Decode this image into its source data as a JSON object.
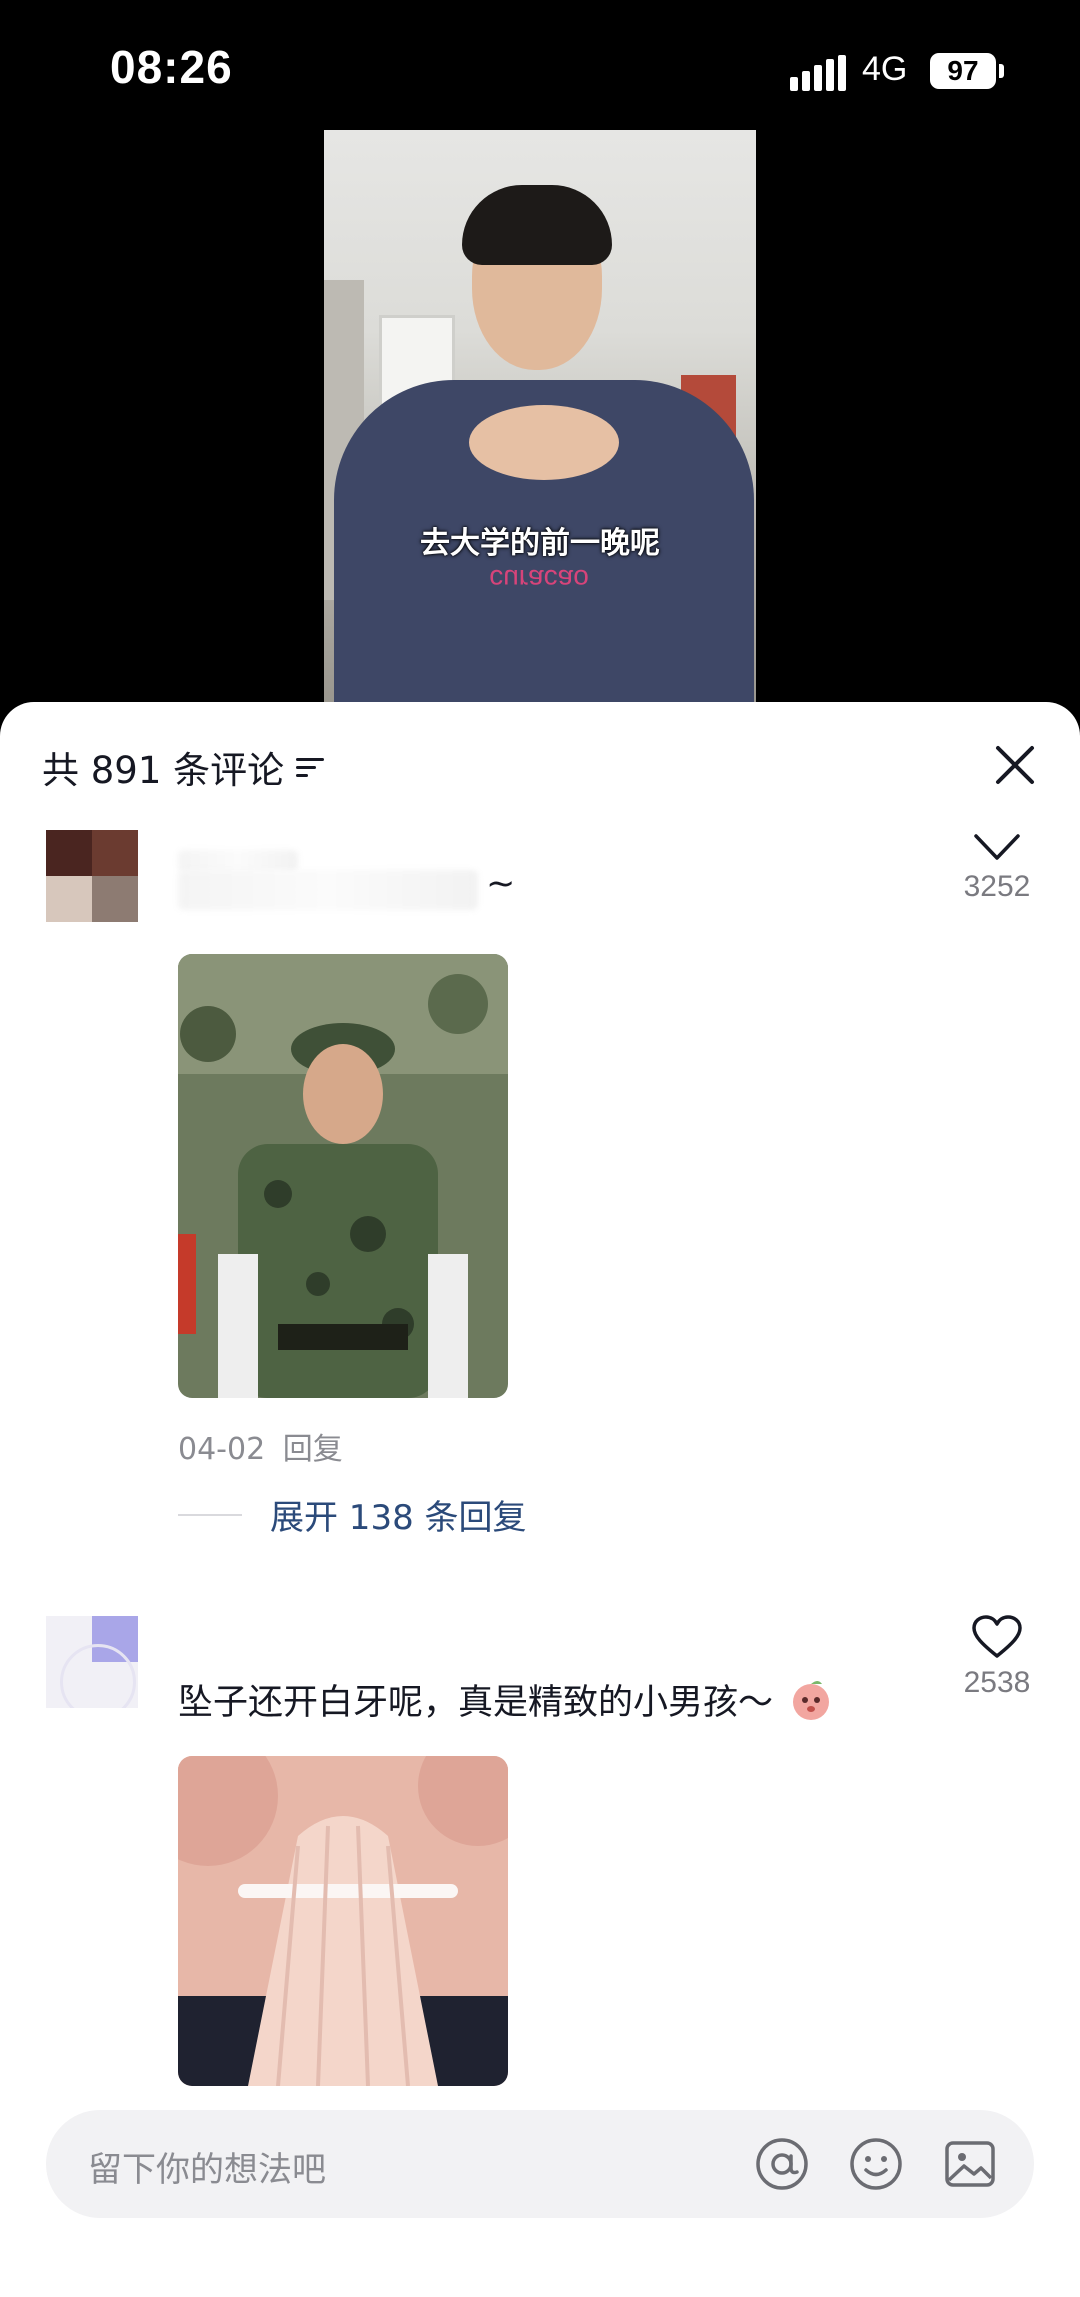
{
  "status_bar": {
    "time": "08:26",
    "network": "4G",
    "battery": "97"
  },
  "video": {
    "caption": "去大学的前一晚呢",
    "shirt_text": "curacao"
  },
  "comments_header": {
    "title": "共 891 条评论"
  },
  "comments": [
    {
      "text_suffix": "~",
      "likes": "3252",
      "date": "04-02",
      "reply_label": "回复",
      "expand_label": "展开 138 条回复"
    },
    {
      "text": "坠子还开白牙呢，真是精致的小男孩～",
      "likes": "2538"
    }
  ],
  "input": {
    "placeholder": "留下你的想法吧"
  },
  "colors": {
    "link": "#2b4a7a",
    "muted": "#8a8b91",
    "text": "#161823"
  }
}
